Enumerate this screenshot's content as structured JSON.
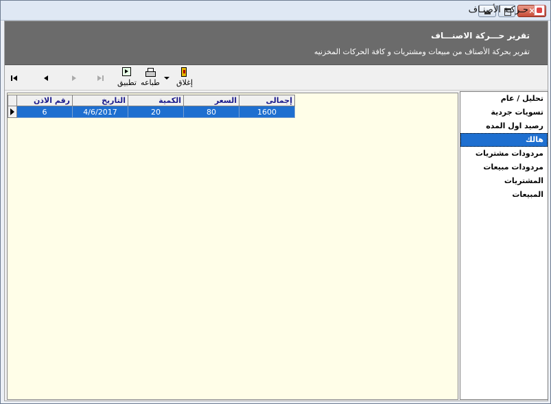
{
  "window": {
    "title": "حـركـة الأصنـاف"
  },
  "header": {
    "title": "تقرير حـــركة الاصنـــاف",
    "subtitle": "تقرير بحركة الأصناف من مبيعات ومشتريات و كافة الحركات المخزنيه"
  },
  "toolbar": {
    "apply_label": "تطبيق",
    "print_label": "طباعه",
    "close_label": "إغلاق"
  },
  "grid": {
    "columns": [
      "رقم الاذن",
      "التاريخ",
      "الكمية",
      "السعر",
      "إجمالى"
    ],
    "rows": [
      [
        "6",
        "4/6/2017",
        "20",
        "80",
        "1600"
      ]
    ]
  },
  "list": {
    "items": [
      "تحليل / عام",
      "تسويات جردية",
      "رصيد اول المده",
      "هالك",
      "مردودات مشتريات",
      "مردودات مبيعات",
      "المشتريات",
      "المبيعات"
    ],
    "selected": "هالك"
  }
}
